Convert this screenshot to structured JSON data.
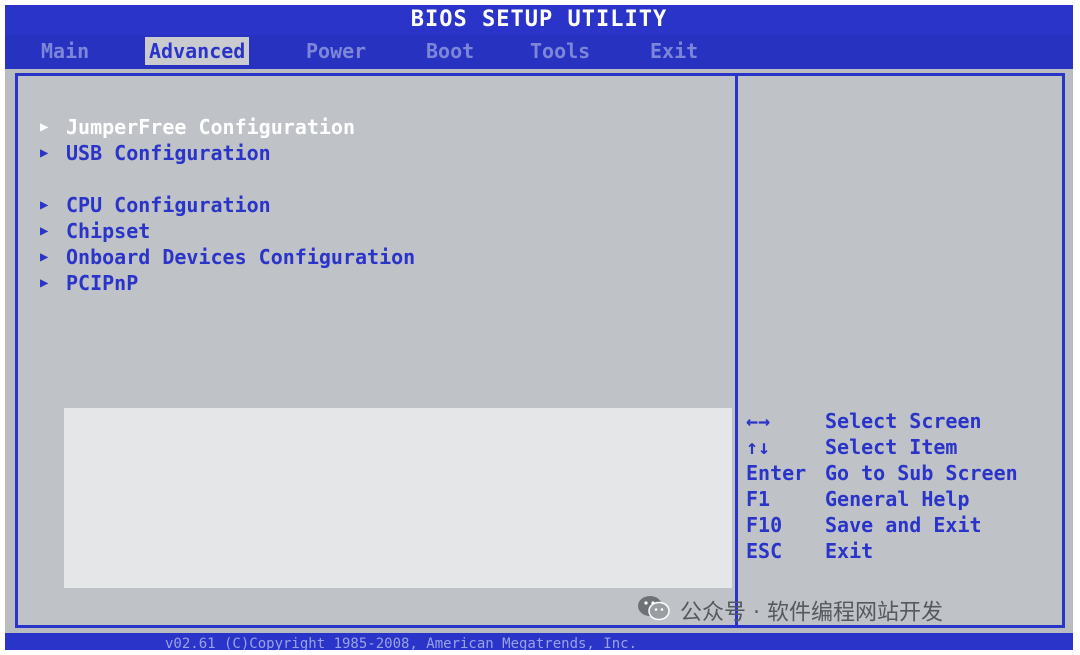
{
  "title": "BIOS SETUP UTILITY",
  "tabs": [
    {
      "label": "Main",
      "active": false
    },
    {
      "label": "Advanced",
      "active": true
    },
    {
      "label": "Power",
      "active": false
    },
    {
      "label": "Boot",
      "active": false
    },
    {
      "label": "Tools",
      "active": false
    },
    {
      "label": "Exit",
      "active": false
    }
  ],
  "menu": [
    {
      "label": "JumperFree Configuration",
      "selected": true
    },
    {
      "label": "USB Configuration"
    },
    {
      "label": "CPU Configuration"
    },
    {
      "label": "Chipset"
    },
    {
      "label": "Onboard Devices Configuration"
    },
    {
      "label": "PCIPnP"
    }
  ],
  "keys": [
    {
      "key": "←→",
      "action": "Select Screen"
    },
    {
      "key": "↑↓",
      "action": "Select Item"
    },
    {
      "key": "Enter",
      "action": "Go to Sub Screen"
    },
    {
      "key": "F1",
      "action": "General Help"
    },
    {
      "key": "F10",
      "action": "Save and Exit"
    },
    {
      "key": "ESC",
      "action": "Exit"
    }
  ],
  "footer": "v02.61 (C)Copyright 1985-2008, American Megatrends, Inc.",
  "watermark": "公众号 · 软件编程网站开发",
  "colors": {
    "accent": "#2a34c8",
    "background": "#b9bcc0",
    "selected_text": "#ffffff"
  }
}
